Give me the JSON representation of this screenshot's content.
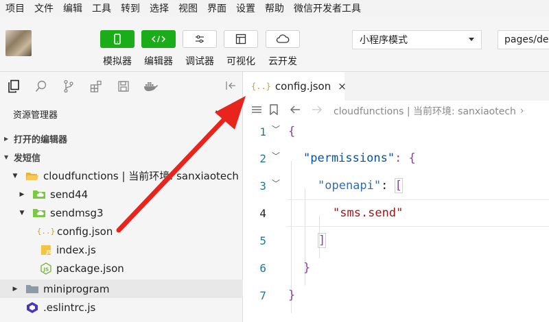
{
  "menu": [
    "项目",
    "文件",
    "编辑",
    "工具",
    "转到",
    "选择",
    "视图",
    "界面",
    "设置",
    "帮助",
    "微信开发者工具"
  ],
  "toolbar": {
    "buttons": [
      {
        "label": "模拟器",
        "icon": "phone-icon"
      },
      {
        "label": "编辑器",
        "icon": "code-icon"
      },
      {
        "label": "调试器",
        "icon": "sliders-icon"
      },
      {
        "label": "可视化",
        "icon": "layout-icon"
      },
      {
        "label": "云开发",
        "icon": "cloud-icon"
      }
    ],
    "mode": "小程序模式",
    "path": "pages/der"
  },
  "explorer": {
    "title": "资源管理器",
    "more": "···",
    "open_editors": "打开的编辑器",
    "project": "发短信",
    "tree": [
      {
        "label": "cloudfunctions | 当前环境: sanxiaotech",
        "icon": "folder-open-icon"
      },
      {
        "label": "send44",
        "icon": "cloud-folder-icon"
      },
      {
        "label": "sendmsg3",
        "icon": "cloud-folder-icon"
      },
      {
        "label": "config.json",
        "icon": "json-icon"
      },
      {
        "label": "index.js",
        "icon": "js-icon"
      },
      {
        "label": "package.json",
        "icon": "nodejs-icon"
      },
      {
        "label": "miniprogram",
        "icon": "folder-icon"
      },
      {
        "label": ".eslintrc.js",
        "icon": "eslint-icon"
      }
    ]
  },
  "editor": {
    "tab": {
      "icon_text": "{..}",
      "label": "config.json",
      "close": "×"
    },
    "breadcrumb": "cloudfunctions | 当前环境: sanxiaotech",
    "code": {
      "l1": "{",
      "l2_key": "\"permissions\"",
      "l2_rest": ": {",
      "l3_key": "\"openapi\"",
      "l3_colon": ": ",
      "l3_bracket": "[",
      "l4": "\"sms.send\"",
      "l5": "]",
      "l6": "}",
      "l7": "}"
    },
    "line_numbers": [
      "1",
      "2",
      "3",
      "4",
      "5",
      "6",
      "7"
    ]
  },
  "colors": {
    "green_button": "#1aad19",
    "arrow": "#e8251c",
    "line_number": "#237893",
    "string": "#a31515",
    "key": "#0451a5"
  }
}
